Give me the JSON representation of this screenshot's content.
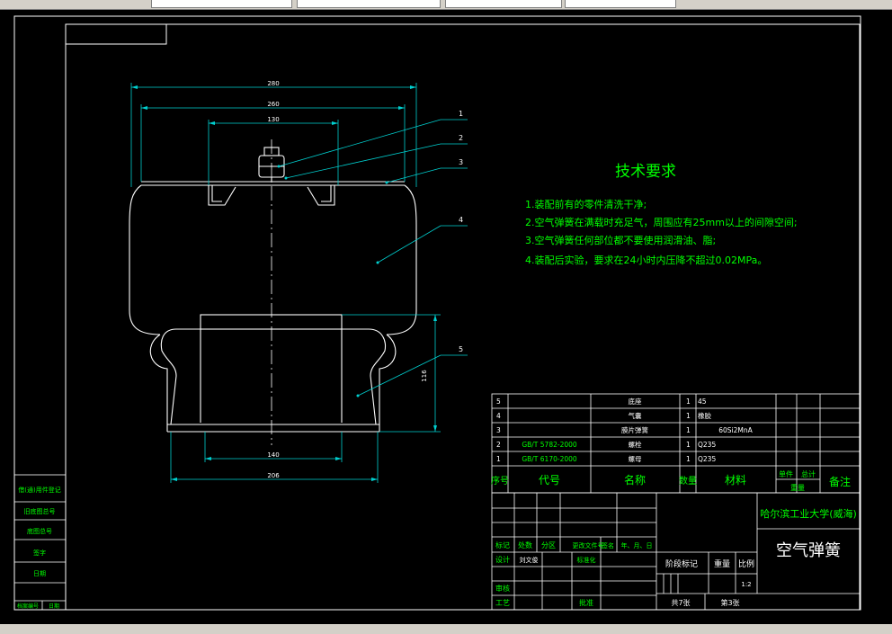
{
  "dims": {
    "d280": "280",
    "d260": "260",
    "d130": "130",
    "d116": "116",
    "d140": "140",
    "d206": "206"
  },
  "leaders": [
    "1",
    "2",
    "3",
    "4",
    "5"
  ],
  "tech": {
    "title": "技术要求",
    "lines": [
      "1.装配前有的零件清洗干净;",
      "2.空气弹簧在满载时充足气，周围应有25mm以上的间隙空间;",
      "3.空气弹簧任何部位都不要使用润滑油、脂;",
      "4.装配后实验，要求在24小时内压降不超过0.02MPa。"
    ]
  },
  "bom": {
    "rows": [
      {
        "no": "5",
        "code": "",
        "name": "底座",
        "qty": "1",
        "material": "45"
      },
      {
        "no": "4",
        "code": "",
        "name": "气囊",
        "qty": "1",
        "material": "橡胶"
      },
      {
        "no": "3",
        "code": "",
        "name": "膜片弹簧",
        "qty": "1",
        "material": "60Si2MnA"
      },
      {
        "no": "2",
        "code": "GB/T 5782-2000",
        "name": "螺栓",
        "qty": "1",
        "material": "Q235"
      },
      {
        "no": "1",
        "code": "GB/T 6170-2000",
        "name": "螺母",
        "qty": "1",
        "material": "Q235"
      }
    ],
    "headers": {
      "no": "序号",
      "code": "代号",
      "name": "名称",
      "qty": "数量",
      "material": "材料",
      "single": "单件",
      "total": "总计",
      "weight": "重量",
      "remark": "备注"
    }
  },
  "titleblock": {
    "school": "哈尔滨工业大学(威海)",
    "drawing": "空气弹簧",
    "row_labels": [
      "标记",
      "处数",
      "分区",
      "更改文件号",
      "签名",
      "年、月、日"
    ],
    "design": "设计",
    "designer": "刘文俊",
    "standardize": "标准化",
    "stage": "阶段标记",
    "weight": "重量",
    "scale": "比例",
    "scale_value": "1:2",
    "review": "审核",
    "process": "工艺",
    "approve": "批准",
    "sheets": "共7张",
    "sheet": "第3张"
  },
  "sidebar": [
    "借(通)用件登记",
    "旧底图总号",
    "底图总号",
    "签字",
    "日期"
  ],
  "sidebar_foot": [
    "档案编号",
    "日期"
  ]
}
